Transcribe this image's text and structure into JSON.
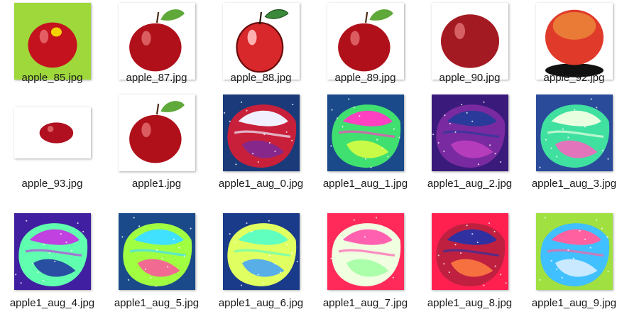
{
  "files": [
    {
      "name": "apple_85.jpg",
      "kind": "green-bg"
    },
    {
      "name": "apple_87.jpg",
      "kind": "leaf-white"
    },
    {
      "name": "apple_88.jpg",
      "kind": "cartoon"
    },
    {
      "name": "apple_89.jpg",
      "kind": "leaf-white"
    },
    {
      "name": "apple_90.jpg",
      "kind": "plain"
    },
    {
      "name": "apple_92.jpg",
      "kind": "shadow"
    },
    {
      "name": "apple_93.jpg",
      "kind": "wide"
    },
    {
      "name": "apple1.jpg",
      "kind": "leaf-white"
    },
    {
      "name": "apple1_aug_0.jpg",
      "kind": "aug",
      "colors": [
        "#1a3a7a",
        "#c8203a",
        "#f0f0ff",
        "#7a2a9a"
      ]
    },
    {
      "name": "apple1_aug_1.jpg",
      "kind": "aug",
      "colors": [
        "#1a4a8a",
        "#40e070",
        "#ff40c0",
        "#e0ff40"
      ]
    },
    {
      "name": "apple1_aug_2.jpg",
      "kind": "aug",
      "colors": [
        "#3a1a7a",
        "#7a2aa0",
        "#2a3a9a",
        "#c040c0"
      ]
    },
    {
      "name": "apple1_aug_3.jpg",
      "kind": "aug",
      "colors": [
        "#2a4a9a",
        "#40e0a0",
        "#e8ffe0",
        "#ff60c0"
      ]
    },
    {
      "name": "apple1_aug_4.jpg",
      "kind": "aug",
      "colors": [
        "#4020a0",
        "#60ffb0",
        "#c040e0",
        "#2030a0"
      ]
    },
    {
      "name": "apple1_aug_5.jpg",
      "kind": "aug",
      "colors": [
        "#1a4a8a",
        "#a0ff40",
        "#40e0ff",
        "#ff50a0"
      ]
    },
    {
      "name": "apple1_aug_6.jpg",
      "kind": "aug",
      "colors": [
        "#1a3a8a",
        "#e0ff60",
        "#60ffc0",
        "#40a0ff"
      ]
    },
    {
      "name": "apple1_aug_7.jpg",
      "kind": "aug",
      "colors": [
        "#ff2a5a",
        "#f0ffe0",
        "#ff60b0",
        "#a0ffa0"
      ]
    },
    {
      "name": "apple1_aug_8.jpg",
      "kind": "aug",
      "colors": [
        "#ff2050",
        "#c02040",
        "#3030a0",
        "#ff8040"
      ]
    },
    {
      "name": "apple1_aug_9.jpg",
      "kind": "aug",
      "colors": [
        "#a0e040",
        "#40c0ff",
        "#ff60a0",
        "#e0f0ff"
      ]
    }
  ]
}
